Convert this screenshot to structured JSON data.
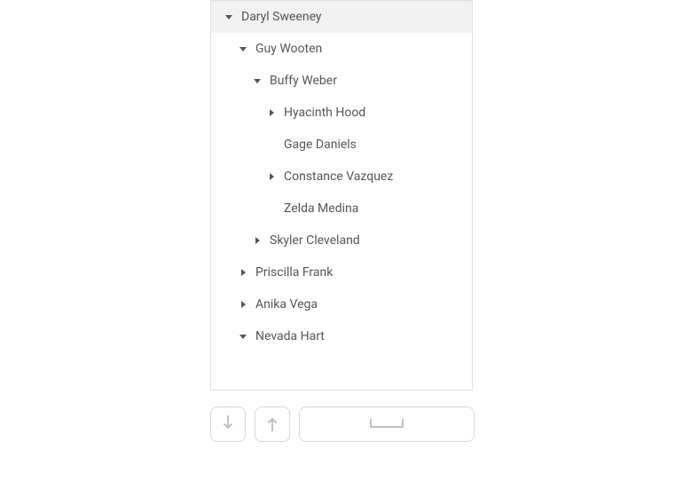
{
  "tree": {
    "nodes": [
      {
        "label": "Daryl Sweeney",
        "depth": 0,
        "state": "expanded",
        "root": true
      },
      {
        "label": "Guy Wooten",
        "depth": 1,
        "state": "expanded"
      },
      {
        "label": "Buffy Weber",
        "depth": 2,
        "state": "expanded"
      },
      {
        "label": "Hyacinth Hood",
        "depth": 3,
        "state": "collapsed"
      },
      {
        "label": "Gage Daniels",
        "depth": 3,
        "state": "leaf"
      },
      {
        "label": "Constance Vazquez",
        "depth": 3,
        "state": "collapsed"
      },
      {
        "label": "Zelda Medina",
        "depth": 3,
        "state": "leaf"
      },
      {
        "label": "Skyler Cleveland",
        "depth": 2,
        "state": "collapsed"
      },
      {
        "label": "Priscilla Frank",
        "depth": 1,
        "state": "collapsed"
      },
      {
        "label": "Anika Vega",
        "depth": 1,
        "state": "collapsed"
      },
      {
        "label": "Nevada Hart",
        "depth": 1,
        "state": "expanded"
      }
    ]
  },
  "toolbar": {
    "button_down": "down",
    "button_up": "up",
    "button_space": "space"
  }
}
